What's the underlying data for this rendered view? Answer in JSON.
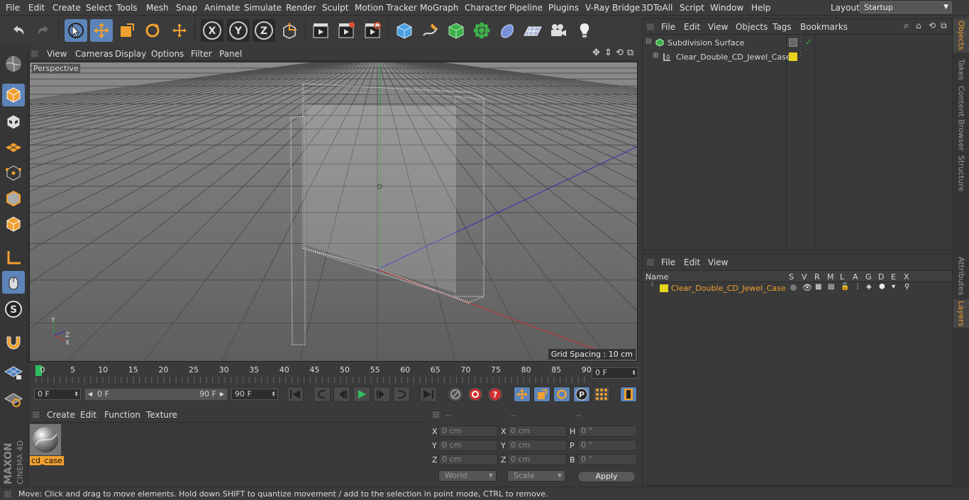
{
  "menubar": {
    "items": [
      "File",
      "Edit",
      "Create",
      "Select",
      "Tools",
      "Mesh",
      "Snap",
      "Animate",
      "Simulate",
      "Render",
      "Sculpt",
      "Motion Tracker",
      "MoGraph",
      "Character",
      "Pipeline",
      "Plugins",
      "V-Ray Bridge",
      "3DToAll",
      "Script",
      "Window",
      "Help"
    ],
    "layout_label": "Layout:",
    "layout_value": "Startup"
  },
  "toolbar": {
    "icons": [
      "undo-icon",
      "redo-icon",
      "live-selection-icon",
      "move-icon",
      "scale-icon",
      "rotate-icon",
      "recent-tools-icon",
      "x-axis-icon",
      "y-axis-icon",
      "z-axis-icon",
      "world-coordinates-icon",
      "render-view-icon",
      "render-picture-viewer-icon",
      "edit-render-settings-icon",
      "cube-primitive-icon",
      "pen-spline-icon",
      "subdivision-generator-icon",
      "cloner-icon",
      "deformer-icon",
      "floor-environment-icon",
      "camera-icon",
      "light-icon"
    ]
  },
  "viewport": {
    "menu": [
      "View",
      "Cameras",
      "Display",
      "Options",
      "Filter",
      "Panel"
    ],
    "camera_label": "Perspective",
    "grid_spacing": "Grid Spacing : 10 cm"
  },
  "timeline": {
    "ticks": [
      "0",
      "5",
      "10",
      "15",
      "20",
      "25",
      "30",
      "35",
      "40",
      "45",
      "50",
      "55",
      "60",
      "65",
      "70",
      "75",
      "80",
      "85",
      "90"
    ],
    "current_frame": "0 F"
  },
  "transport": {
    "start_field": "0 F",
    "range_start": "0 F",
    "range_end": "90 F",
    "end_field": "90 F"
  },
  "materials": {
    "menu": [
      "Create",
      "Edit",
      "Function",
      "Texture"
    ],
    "items": [
      {
        "name": "cd_case"
      }
    ]
  },
  "coordinates": {
    "headers": [
      "--",
      "--",
      "--"
    ],
    "rows": [
      {
        "a": "X",
        "av": "0 cm",
        "b": "X",
        "bv": "0 cm",
        "c": "H",
        "cv": "0 °"
      },
      {
        "a": "Y",
        "av": "0 cm",
        "b": "Y",
        "bv": "0 cm",
        "c": "P",
        "cv": "0 °"
      },
      {
        "a": "Z",
        "av": "0 cm",
        "b": "Z",
        "bv": "0 cm",
        "c": "B",
        "cv": "0 °"
      }
    ],
    "mode": "World",
    "mode2": "Scale",
    "apply": "Apply"
  },
  "status": "Move: Click and drag to move elements. Hold down SHIFT to quantize movement / add to the selection in point mode, CTRL to remove.",
  "objects_panel": {
    "menu": [
      "File",
      "Edit",
      "View",
      "Objects",
      "Tags",
      "Bookmarks"
    ],
    "items": [
      {
        "name": "Subdivision Surface",
        "color": "#d8d8d8"
      },
      {
        "name": "Clear_Double_CD_Jewel_Case",
        "color": "#d8d8d8"
      }
    ]
  },
  "layers_panel": {
    "menu": [
      "File",
      "Edit",
      "View"
    ],
    "columns": [
      "Name",
      "S",
      "V",
      "R",
      "M",
      "L",
      "A",
      "G",
      "D",
      "E",
      "X"
    ],
    "layer_name": "Clear_Double_CD_Jewel_Case",
    "layer_color": "#e6d21e"
  },
  "right_tabs": [
    "Objects",
    "Takes",
    "Content Browser",
    "Structure",
    "Attributes",
    "Layers"
  ],
  "brand": {
    "line1": "MAXON",
    "line2": "CINEMA 4D"
  },
  "colors": {
    "accent": "#5d84b8",
    "highlight": "#f0a030",
    "selection": "#e6d21e"
  }
}
